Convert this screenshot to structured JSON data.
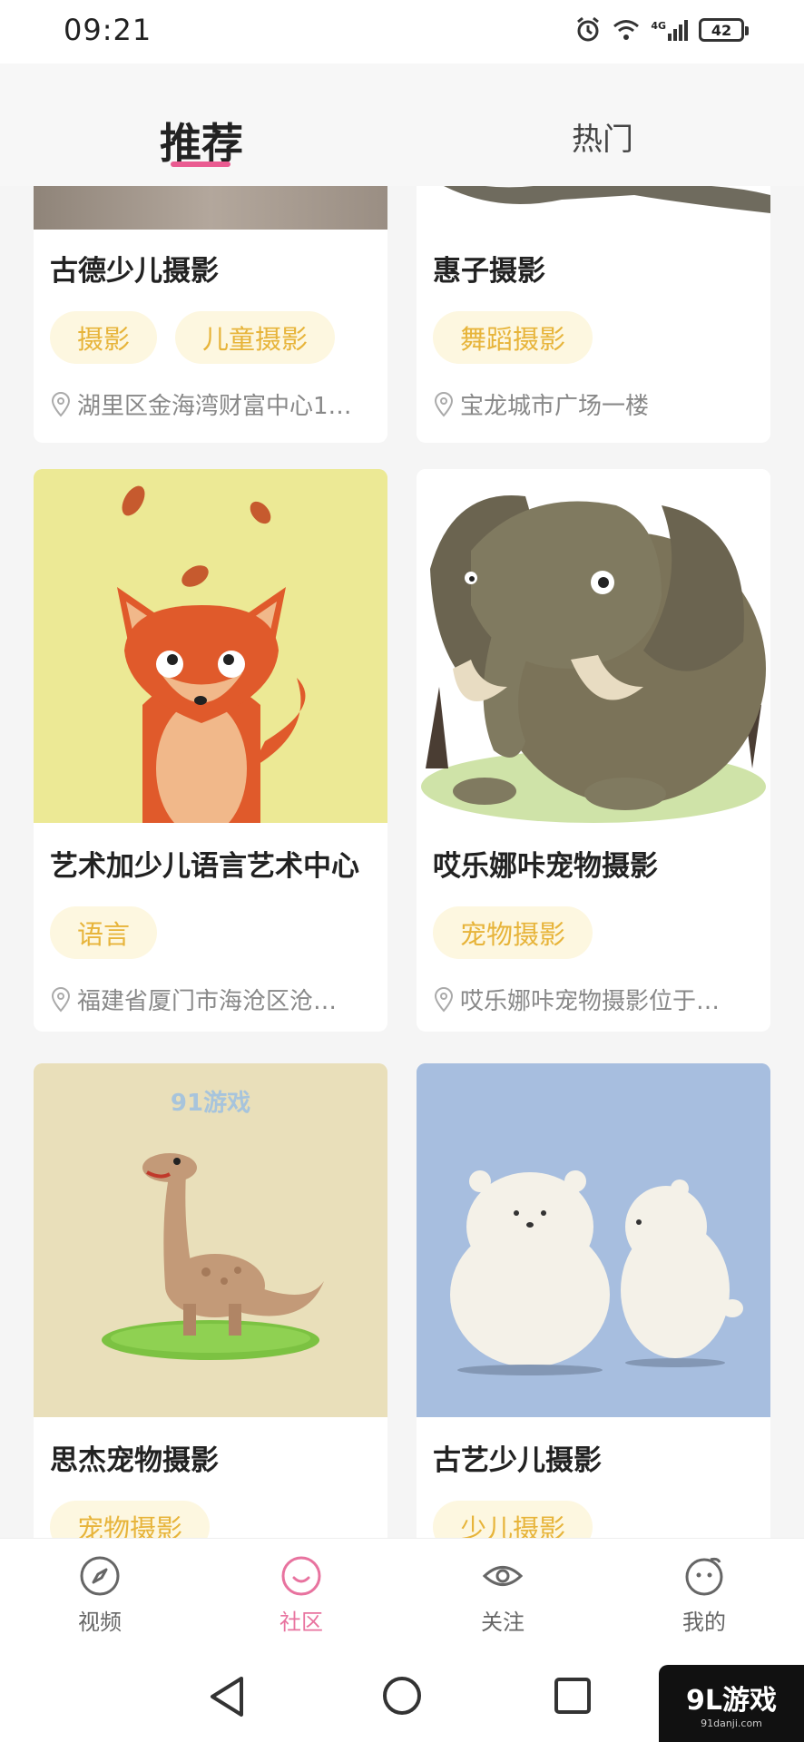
{
  "status_bar": {
    "time": "09:21",
    "battery": "42",
    "network": "4G"
  },
  "tabs": [
    {
      "label": "推荐",
      "active": true
    },
    {
      "label": "热门",
      "active": false
    }
  ],
  "cards": [
    {
      "title": "古德少儿摄影",
      "tags": [
        "摄影",
        "儿童摄影"
      ],
      "location": "湖里区金海湾财富中心1…"
    },
    {
      "title": "惠子摄影",
      "tags": [
        "舞蹈摄影"
      ],
      "location": "宝龙城市广场一楼"
    },
    {
      "title": "艺术加少儿语言艺术中心",
      "tags": [
        "语言"
      ],
      "location": "福建省厦门市海沧区沧…"
    },
    {
      "title": "哎乐娜咔宠物摄影",
      "tags": [
        "宠物摄影"
      ],
      "location": "哎乐娜咔宠物摄影位于…"
    },
    {
      "title": "思杰宠物摄影",
      "tags": [
        "宠物摄影"
      ],
      "location": ""
    },
    {
      "title": "古艺少儿摄影",
      "tags": [
        "少儿摄影"
      ],
      "location": ""
    }
  ],
  "bottom_nav": [
    {
      "label": "视频",
      "icon": "compass-icon",
      "active": false
    },
    {
      "label": "社区",
      "icon": "smile-icon",
      "active": true
    },
    {
      "label": "关注",
      "icon": "eye-icon",
      "active": false
    },
    {
      "label": "我的",
      "icon": "face-icon",
      "active": false
    }
  ],
  "watermark": {
    "main": "9L游戏",
    "sub": "91danji.com"
  },
  "image_watermark": "91游戏",
  "colors": {
    "accent": "#ea5b91",
    "tag_bg": "#fdf7e0",
    "tag_text": "#e7b43a"
  }
}
